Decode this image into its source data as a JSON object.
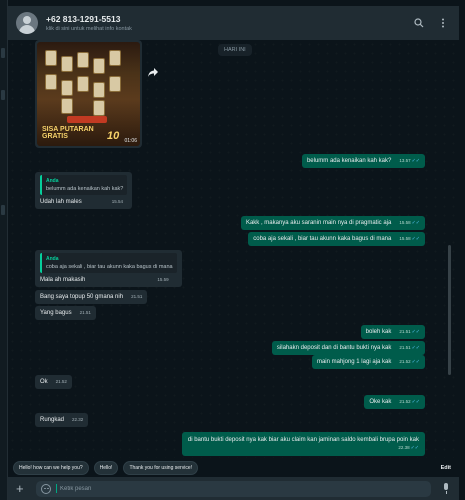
{
  "header": {
    "contact_name": "+62 813-1291-5513",
    "subtitle": "klik di sini untuk melihat info kontak",
    "icons": [
      "search-icon",
      "more-vert-icon"
    ]
  },
  "chat": {
    "date_chip": "HARI INI",
    "media": {
      "duration": "01:06",
      "overlay_text_1": "SISA PUTARAN",
      "overlay_text_2": "GRATIS",
      "overlay_number": "10"
    },
    "messages": [
      {
        "dir": "out",
        "text": "belumm ada kenaikan kah kak?",
        "time": "13.57"
      },
      {
        "dir": "in",
        "quote_author": "Anda",
        "quote_text": "belumm ada kenaikan kah kak?",
        "text": "Udah lah males",
        "time": "15.54"
      },
      {
        "dir": "out",
        "text": "Kakk , makanya aku saranin main nya di pragmatic aja",
        "time": "15.58"
      },
      {
        "dir": "out",
        "text": "coba aja sekali , biar tau akunn kaka bagus di mana",
        "time": "15.58"
      },
      {
        "dir": "in",
        "quote_author": "Anda",
        "quote_text": "coba aja sekali , biar tau akunn kaka bagus di mana",
        "text": "Mala ah makasih",
        "time": "15.59"
      },
      {
        "dir": "in",
        "text": "Bang saya topup 50 gmana nih",
        "time": "21.51"
      },
      {
        "dir": "in",
        "text": "Yang bagus",
        "time": "21.51"
      },
      {
        "dir": "out",
        "text": "boleh kak",
        "time": "21.51"
      },
      {
        "dir": "out",
        "text": "silahakn deposit dan di bantu bukti nya kak",
        "time": "21.51"
      },
      {
        "dir": "out",
        "text": "main mahjong 1 lagi aja kak",
        "time": "21.52"
      },
      {
        "dir": "in",
        "text": "Ok",
        "time": "21.52"
      },
      {
        "dir": "out",
        "text": "Oke kak",
        "time": "21.52"
      },
      {
        "dir": "in",
        "text": "Rungkad",
        "time": "22.32"
      },
      {
        "dir": "out",
        "text": "di bantu bukti deposit nya kak biar aku claim kan jaminan saldo kembali brupa poin kak",
        "time": "22.38"
      }
    ]
  },
  "quick_replies": {
    "items": [
      "Hello! how can we help you?",
      "Hello!",
      "Thank you for using service!"
    ],
    "edit_label": "Edit"
  },
  "composer": {
    "placeholder": "Ketik pesan"
  },
  "colors": {
    "outgoing_bubble": "#005c4b",
    "incoming_bubble": "#202c33",
    "accent": "#06cf9c",
    "read_ticks": "#53bdeb"
  }
}
